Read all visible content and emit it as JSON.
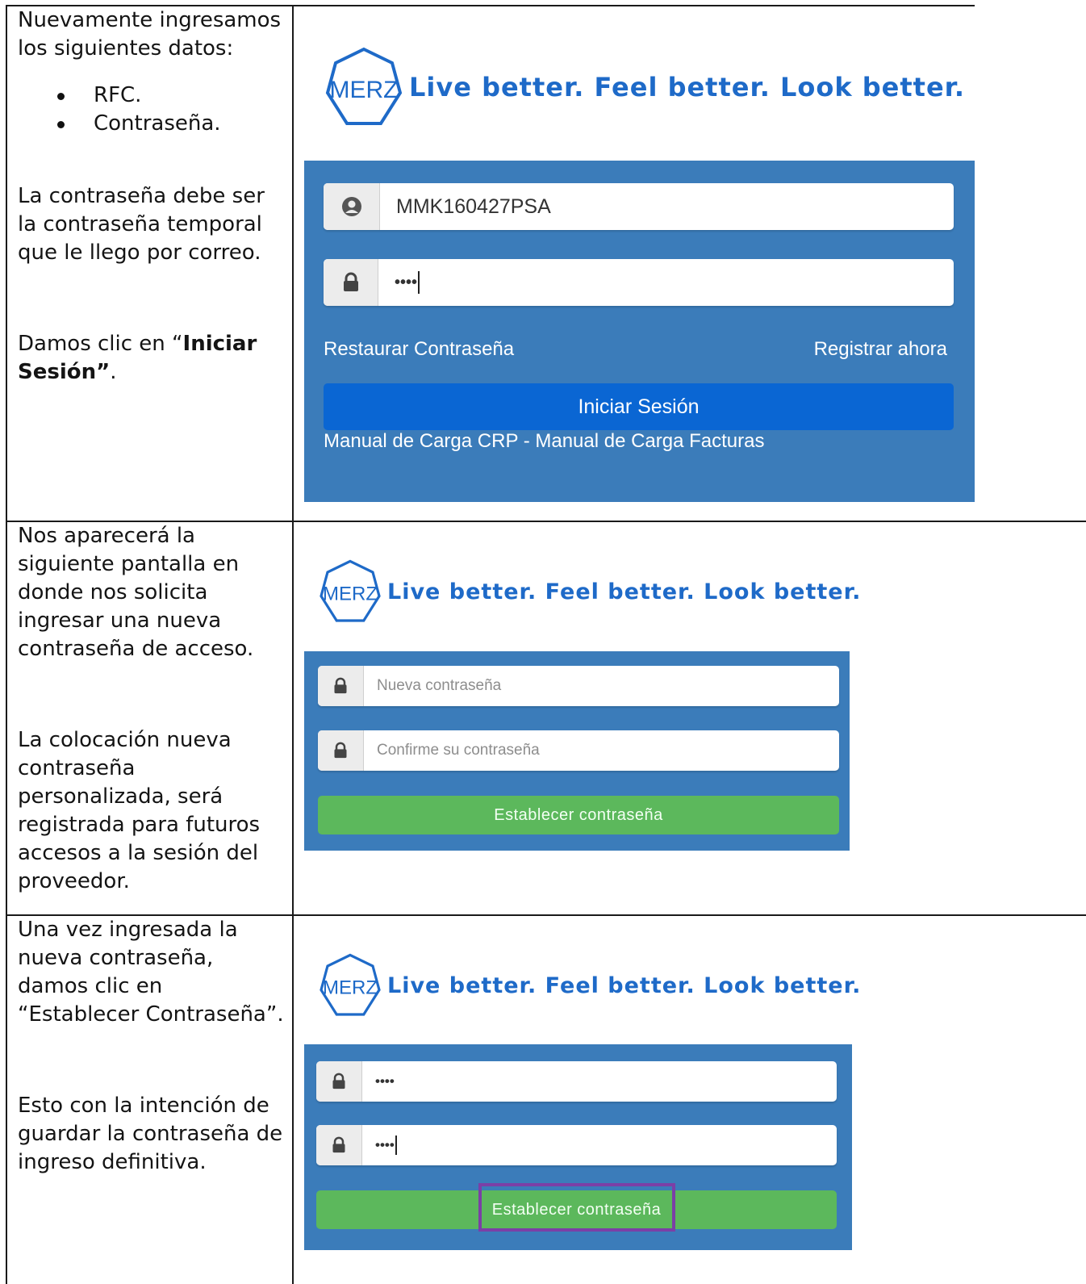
{
  "rows": [
    {
      "intro": "Nuevamente ingresamos los siguientes datos:",
      "bullets": [
        "RFC.",
        "Contraseña."
      ],
      "note": "La contraseña debe ser la contraseña temporal que le llego por correo.",
      "action_prefix": "Damos clic en “",
      "action_bold": "Iniciar Sesión”",
      "action_suffix": "."
    },
    {
      "para1": "Nos aparecerá la siguiente pantalla en donde nos solicita ingresar una nueva contraseña de acceso.",
      "para2": "La colocación nueva contraseña personalizada, será registrada para futuros accesos a la sesión del proveedor."
    },
    {
      "para1": "Una vez ingresada la nueva contraseña, damos clic en “Establecer Contraseña”.",
      "para2": "Esto con la intención de guardar la contraseña de ingreso definitiva."
    }
  ],
  "logo": {
    "brand": "MERZ",
    "tagline": "Live better. Feel better. Look better."
  },
  "login_form": {
    "rfc_value": "MMK160427PSA",
    "password_value": "••••",
    "restore_link": "Restaurar Contraseña",
    "register_link": "Registrar ahora",
    "login_button": "Iniciar Sesión",
    "manuals_link": "Manual de Carga CRP - Manual de Carga Facturas"
  },
  "new_password_form": {
    "new_placeholder": "Nueva contraseña",
    "confirm_placeholder": "Confirme su contraseña",
    "submit_button": "Establecer contraseña"
  },
  "filled_password_form": {
    "new_value": "••••",
    "confirm_value": "••••",
    "submit_button": "Establecer contraseña"
  },
  "colors": {
    "panel_blue": "#3b7cba",
    "button_blue": "#0a66d3",
    "button_green": "#5cb85c",
    "brand_blue": "#1e6ac8",
    "highlight_purple": "#7b3fa6"
  }
}
